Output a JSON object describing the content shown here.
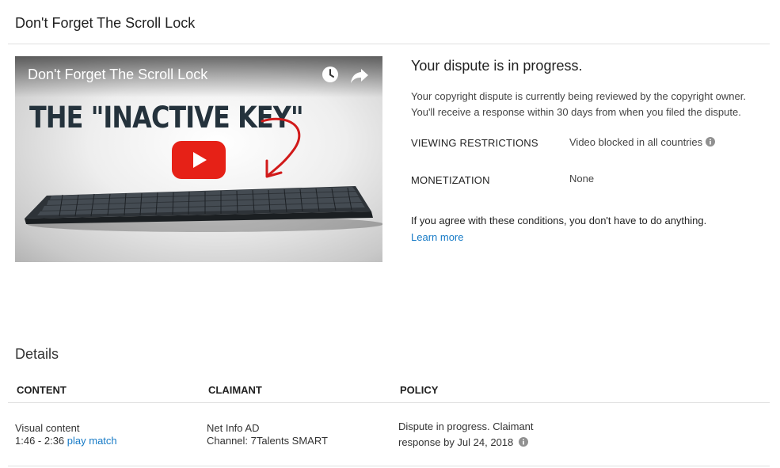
{
  "page": {
    "title": "Don't Forget The Scroll Lock"
  },
  "video": {
    "title": "Don't Forget The Scroll Lock",
    "thumbnail_text": "THE \"INACTIVE KEY\"",
    "icons": [
      "clock-icon",
      "share-icon",
      "play-icon"
    ]
  },
  "dispute": {
    "heading": "Your dispute is in progress.",
    "description": "Your copyright dispute is currently being reviewed by the copyright owner. You'll receive a response within 30 days from when you filed the dispute.",
    "restrictions_label": "VIEWING RESTRICTIONS",
    "restrictions_value": "Video blocked in all countries",
    "monetization_label": "MONETIZATION",
    "monetization_value": "None",
    "agree_text": "If you agree with these conditions, you don't have to do anything.",
    "learn_more": "Learn more"
  },
  "details": {
    "heading": "Details",
    "columns": [
      "CONTENT",
      "CLAIMANT",
      "POLICY"
    ],
    "rows": [
      {
        "content_type": "Visual content",
        "time_range": "1:46 - 2:36",
        "match_link": "play match",
        "claimant_name": "Net Info AD",
        "claimant_channel": "Channel: 7Talents SMART",
        "policy_line1": "Dispute in progress. Claimant",
        "policy_line2": "response by Jul 24, 2018"
      }
    ]
  },
  "colors": {
    "link": "#167ac6",
    "play_red": "#e62117",
    "divider": "#e0e0e0"
  }
}
